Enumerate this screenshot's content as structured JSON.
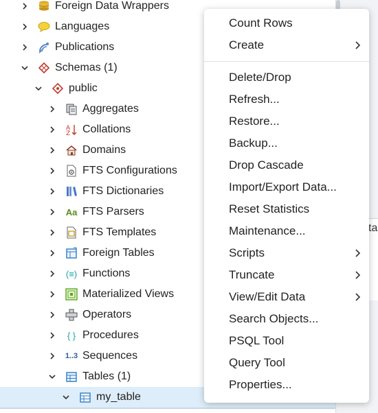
{
  "tree": {
    "items": [
      {
        "label": "Foreign Data Wrappers",
        "icon": "database-stack-icon"
      },
      {
        "label": "Languages",
        "icon": "speech-bubble-icon"
      },
      {
        "label": "Publications",
        "icon": "satellite-dish-icon"
      },
      {
        "label": "Schemas (1)",
        "icon": "schemas-icon"
      },
      {
        "label": "public",
        "icon": "schema-diamond-icon"
      },
      {
        "label": "Aggregates",
        "icon": "aggregate-icon"
      },
      {
        "label": "Collations",
        "icon": "collation-icon"
      },
      {
        "label": "Domains",
        "icon": "domain-house-icon"
      },
      {
        "label": "FTS Configurations",
        "icon": "fts-config-icon"
      },
      {
        "label": "FTS Dictionaries",
        "icon": "fts-dictionary-icon"
      },
      {
        "label": "FTS Parsers",
        "icon": "fts-parser-icon",
        "icon_text": "Aa"
      },
      {
        "label": "FTS Templates",
        "icon": "fts-template-icon"
      },
      {
        "label": "Foreign Tables",
        "icon": "foreign-table-icon"
      },
      {
        "label": "Functions",
        "icon": "function-icon",
        "icon_text": "(≡)"
      },
      {
        "label": "Materialized Views",
        "icon": "materialized-view-icon"
      },
      {
        "label": "Operators",
        "icon": "operator-icon"
      },
      {
        "label": "Procedures",
        "icon": "procedure-icon",
        "icon_text": "{ }"
      },
      {
        "label": "Sequences",
        "icon": "sequence-icon",
        "icon_text": "1..3"
      },
      {
        "label": "Tables (1)",
        "icon": "tables-icon"
      },
      {
        "label": "my_table",
        "icon": "table-icon"
      }
    ]
  },
  "context_menu": {
    "items": [
      {
        "label": "Count Rows"
      },
      {
        "label": "Create",
        "submenu": true
      },
      {
        "label": "Delete/Drop"
      },
      {
        "label": "Refresh..."
      },
      {
        "label": "Restore..."
      },
      {
        "label": "Backup..."
      },
      {
        "label": "Drop Cascade"
      },
      {
        "label": "Import/Export Data..."
      },
      {
        "label": "Reset Statistics"
      },
      {
        "label": "Maintenance..."
      },
      {
        "label": "Scripts",
        "submenu": true
      },
      {
        "label": "Truncate",
        "submenu": true
      },
      {
        "label": "View/Edit Data",
        "submenu": true
      },
      {
        "label": "Search Objects..."
      },
      {
        "label": "PSQL Tool"
      },
      {
        "label": "Query Tool"
      },
      {
        "label": "Properties..."
      }
    ]
  },
  "edge_panel": {
    "partial_text": "ta"
  },
  "colors": {
    "selected_row": "#ddeefa",
    "accent_blue": "#1f6fb5"
  }
}
